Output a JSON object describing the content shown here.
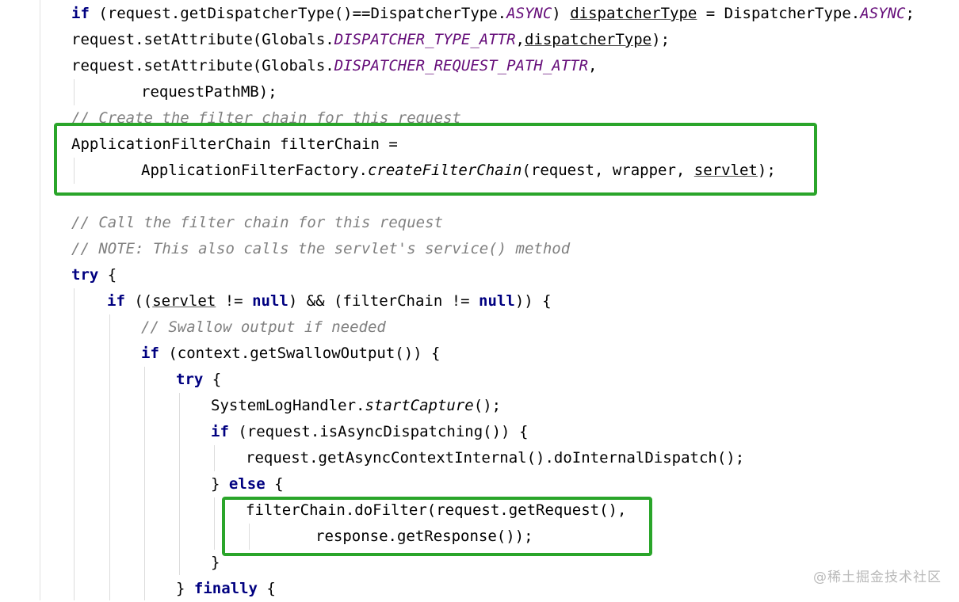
{
  "code": {
    "l1": {
      "if_kw": "if",
      "a": " (request.getDispatcherType()==DispatcherType.",
      "async1": "ASYNC",
      "b": ") ",
      "var": "dispatcherType",
      "c": " = DispatcherType.",
      "async2": "ASYNC",
      "d": ";"
    },
    "l2": {
      "a": "request.setAttribute(Globals.",
      "const": "DISPATCHER_TYPE_ATTR",
      "b": ",",
      "var": "dispatcherType",
      "c": ");"
    },
    "l3": {
      "a": "request.setAttribute(Globals.",
      "const": "DISPATCHER_REQUEST_PATH_ATTR",
      "b": ","
    },
    "l4": {
      "a": "requestPathMB);"
    },
    "l5": {
      "comment": "// Create the filter chain for this request"
    },
    "l6": {
      "a": "ApplicationFilterChain filterChain ="
    },
    "l7": {
      "a": "ApplicationFilterFactory.",
      "method": "createFilterChain",
      "b": "(request, wrapper, ",
      "var": "servlet",
      "c": ");"
    },
    "l8": {
      "comment": "// Call the filter chain for this request"
    },
    "l9": {
      "comment": "// NOTE: This also calls the servlet's service() method"
    },
    "l10": {
      "kw": "try",
      "a": " {"
    },
    "l11": {
      "kw": "if",
      "a": " ((",
      "var": "servlet",
      "b": " != ",
      "null1": "null",
      "c": ") && (filterChain != ",
      "null2": "null",
      "d": ")) {"
    },
    "l12": {
      "comment": "// Swallow output if needed"
    },
    "l13": {
      "kw": "if",
      "a": " (context.getSwallowOutput()) {"
    },
    "l14": {
      "kw": "try",
      "a": " {"
    },
    "l15": {
      "a": "SystemLogHandler.",
      "method": "startCapture",
      "b": "();"
    },
    "l16": {
      "kw": "if",
      "a": " (request.isAsyncDispatching()) {"
    },
    "l17": {
      "a": "request.getAsyncContextInternal().doInternalDispatch();"
    },
    "l18": {
      "a": "} ",
      "kw": "else",
      "b": " {"
    },
    "l19": {
      "a": "filterChain.doFilter(request.getRequest(),"
    },
    "l20": {
      "a": "response.getResponse());"
    },
    "l21": {
      "a": "}"
    },
    "l22": {
      "a": "} ",
      "kw": "finally",
      "b": " {"
    }
  },
  "watermark": "@稀土掘金技术社区",
  "colors": {
    "keyword": "#000080",
    "constant": "#660e7a",
    "comment": "#808080",
    "highlight_box": "#2aa52a"
  }
}
